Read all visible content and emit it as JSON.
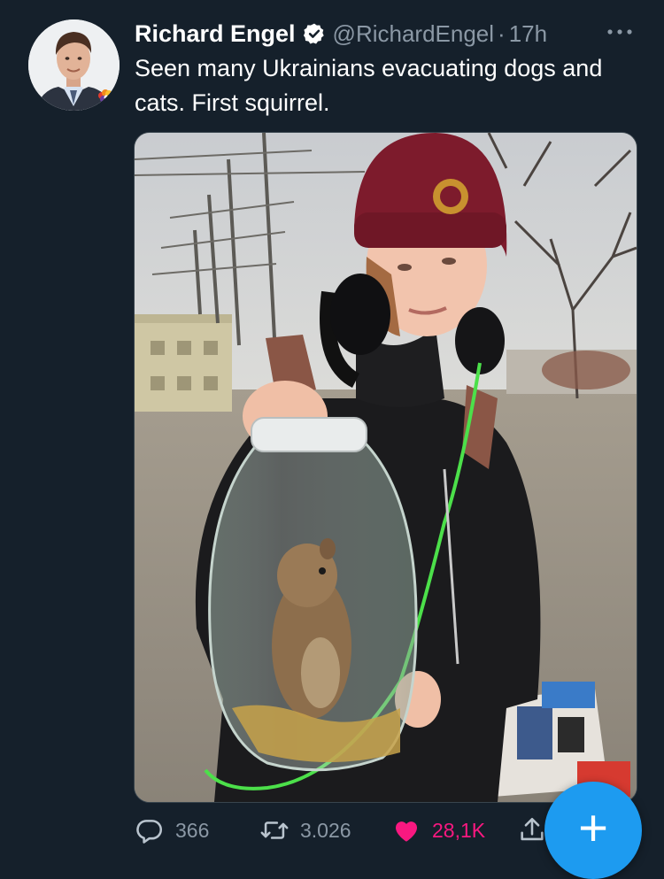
{
  "tweet": {
    "author": {
      "display_name": "Richard Engel",
      "handle": "@RichardEngel",
      "verified": true,
      "time": "17h",
      "separator": "·"
    },
    "text": "Seen many Ukrainians evacuating dogs and cats. First squirrel.",
    "media": {
      "type": "photo",
      "subject": "person-holding-glass-jar-with-squirrel"
    },
    "actions": {
      "reply": {
        "icon": "reply-icon",
        "count": "366"
      },
      "retweet": {
        "icon": "retweet-icon",
        "count": "3.026"
      },
      "like": {
        "icon": "heart-icon",
        "count": "28,1K",
        "active": true
      },
      "share": {
        "icon": "share-icon"
      }
    }
  },
  "fab": {
    "icon": "plus-icon",
    "label": "+"
  },
  "colors": {
    "background": "#15202b",
    "text": "#ffffff",
    "muted": "#8b98a5",
    "like": "#f91880",
    "accent": "#1d9bf0"
  }
}
